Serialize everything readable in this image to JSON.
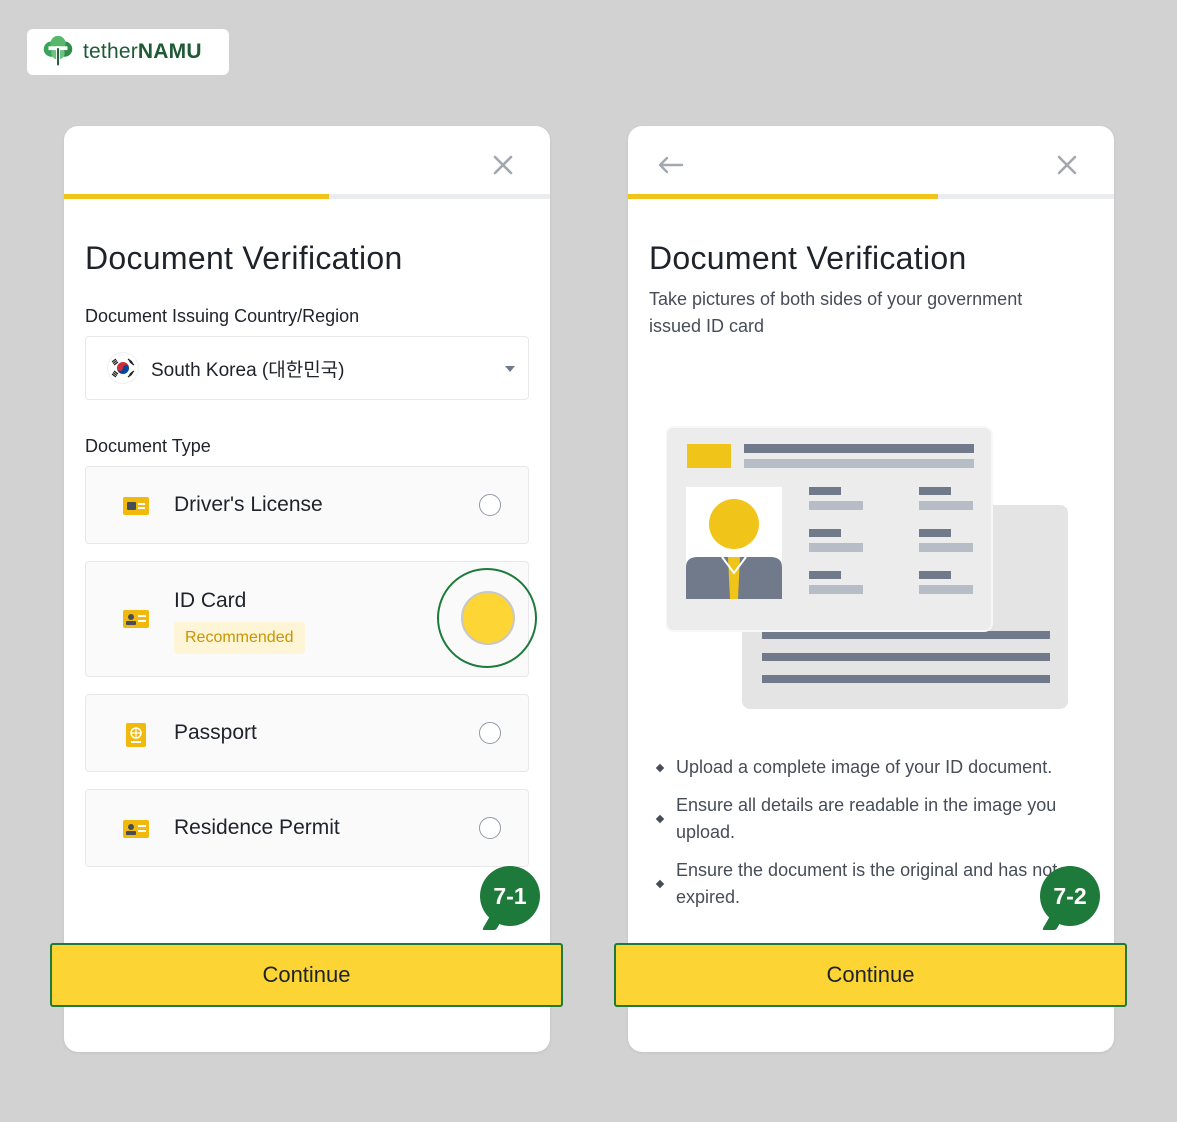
{
  "brand": {
    "light": "tether",
    "bold": "NAMU"
  },
  "screen1": {
    "title": "Document Verification",
    "country_label": "Document Issuing Country/Region",
    "country_value": "South Korea (대한민국)",
    "doc_type_label": "Document Type",
    "options": [
      {
        "label": "Driver's License",
        "selected": false
      },
      {
        "label": "ID Card",
        "badge": "Recommended",
        "selected": true
      },
      {
        "label": "Passport",
        "selected": false
      },
      {
        "label": "Residence Permit",
        "selected": false
      }
    ],
    "step": "7-1",
    "continue_label": "Continue",
    "progress_fraction": 0.54
  },
  "screen2": {
    "title": "Document Verification",
    "subtitle": "Take pictures of both sides of your government issued ID card",
    "bullets": [
      "Upload a complete image of your ID document.",
      "Ensure all details are readable in the image you upload.",
      "Ensure the document is the original and has not expired."
    ],
    "step": "7-2",
    "continue_label": "Continue",
    "progress_fraction": 0.64
  },
  "colors": {
    "accent": "#fcd535",
    "progress": "#f0c419",
    "highlight": "#1e7a3a",
    "badge_text": "#c99400"
  },
  "icons": [
    "tether-namu-logo",
    "close-icon",
    "back-arrow-icon",
    "korea-flag-icon",
    "driver-license-icon",
    "id-card-icon",
    "passport-icon",
    "residence-permit-icon",
    "chevron-down-icon"
  ]
}
